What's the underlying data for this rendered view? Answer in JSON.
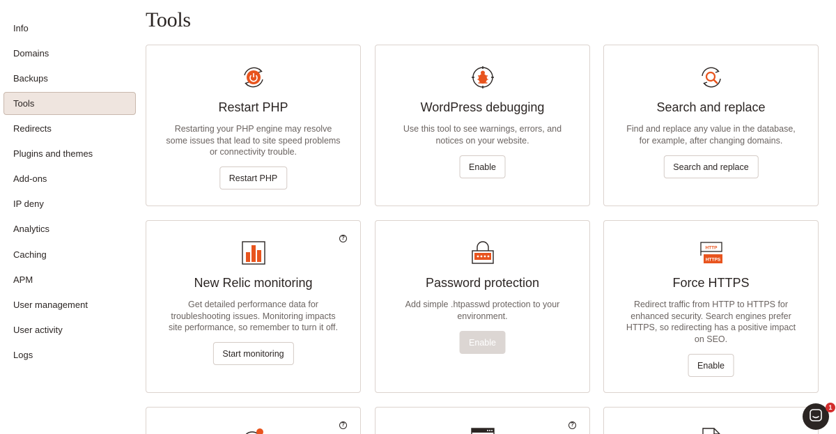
{
  "page": {
    "title": "Tools"
  },
  "sidebar": {
    "items": [
      {
        "label": "Info"
      },
      {
        "label": "Domains"
      },
      {
        "label": "Backups"
      },
      {
        "label": "Tools",
        "active": true
      },
      {
        "label": "Redirects"
      },
      {
        "label": "Plugins and themes"
      },
      {
        "label": "Add-ons"
      },
      {
        "label": "IP deny"
      },
      {
        "label": "Analytics"
      },
      {
        "label": "Caching"
      },
      {
        "label": "APM"
      },
      {
        "label": "User management"
      },
      {
        "label": "User activity"
      },
      {
        "label": "Logs"
      }
    ]
  },
  "cards": {
    "restart_php": {
      "icon": "restart-power-icon",
      "title": "Restart PHP",
      "description": "Restarting your PHP engine may resolve some issues that lead to site speed problems or connectivity trouble.",
      "button": "Restart PHP"
    },
    "wp_debugging": {
      "icon": "bug-icon",
      "title": "WordPress debugging",
      "description": "Use this tool to see warnings, errors, and notices on your website.",
      "button": "Enable"
    },
    "search_replace": {
      "icon": "search-replace-icon",
      "title": "Search and replace",
      "description": "Find and replace any value in the database, for example, after changing domains.",
      "button": "Search and replace"
    },
    "new_relic": {
      "icon": "bar-chart-icon",
      "title": "New Relic monitoring",
      "description": "Get detailed performance data for troubleshooting issues. Monitoring impacts site performance, so remember to turn it off.",
      "button": "Start monitoring",
      "help": "?"
    },
    "password_protection": {
      "icon": "lock-icon",
      "title": "Password protection",
      "description": "Add simple .htpasswd protection to your environment.",
      "button": "Enable",
      "button_disabled": true
    },
    "force_https": {
      "icon": "http-https-icon",
      "title": "Force HTTPS",
      "description": "Redirect traffic from HTTP to HTTPS for enhanced security. Search engines prefer HTTPS, so redirecting has a positive impact on SEO.",
      "button": "Enable",
      "http_label": "HTTP",
      "https_label": "HTTPS"
    },
    "bottom_left": {
      "icon": "globe-badge-icon",
      "help": "?"
    },
    "bottom_middle": {
      "icon": "browser-window-icon",
      "help": "?"
    },
    "bottom_right": {
      "icon": "document-icon"
    }
  },
  "chat": {
    "icon": "chat-icon",
    "badge": "1"
  },
  "colors": {
    "accent": "#e8541e",
    "text": "#2b2523",
    "muted": "#6b6461",
    "border": "#dcd3ce",
    "active_bg": "#efe5df"
  }
}
